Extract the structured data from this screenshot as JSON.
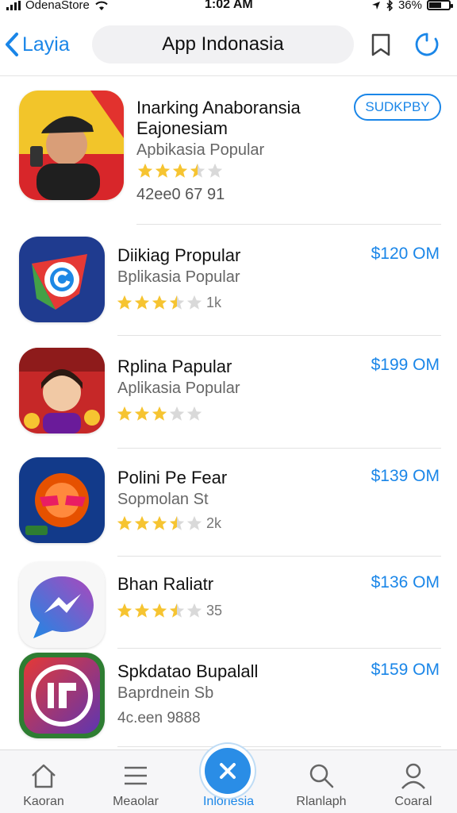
{
  "status_bar": {
    "carrier": "OdenaStore",
    "time": "1:02 AM",
    "battery": "36%"
  },
  "nav": {
    "back_label": "Layia",
    "search_text": "App Indonasia"
  },
  "apps": [
    {
      "title_line1": "Inarking Anaboransia",
      "title_line2": "Eajonesiam",
      "subtitle": "Apbikasia Popular",
      "rating_count": "",
      "meta": "42ee0 67 91",
      "action": "SUDKPBY",
      "stars": 3.5
    },
    {
      "title_line1": "Diikiag Propular",
      "subtitle": "Bplikasia Popular",
      "rating_count": "1k",
      "price": "$120 OM",
      "stars": 3.5
    },
    {
      "title_line1": "Rplina Papular",
      "subtitle": "Aplikasia Popular",
      "rating_count": "",
      "price": "$199 OM",
      "stars": 3.0
    },
    {
      "title_line1": "Polini Pe Fear",
      "subtitle": "Sopmolan St",
      "rating_count": "2k",
      "price": "$139 OM",
      "stars": 3.5
    },
    {
      "title_line1": "Bhan Raliatr",
      "subtitle": "",
      "rating_count": "35",
      "price": "$136 OM",
      "stars": 3.5
    },
    {
      "title_line1": "Spkdatao Bupalall",
      "subtitle": "Baprdnein Sb",
      "meta": "4c.een 9888",
      "price": "$159 OM"
    }
  ],
  "tabs": [
    {
      "label": "Kaoran"
    },
    {
      "label": "Meaolar"
    },
    {
      "label": "Inlonesia"
    },
    {
      "label": "Rlanlaph"
    },
    {
      "label": "Coaral"
    }
  ],
  "colors": {
    "accent": "#1a86e8",
    "star": "#f6c431",
    "star_empty": "#d9d9d9"
  }
}
